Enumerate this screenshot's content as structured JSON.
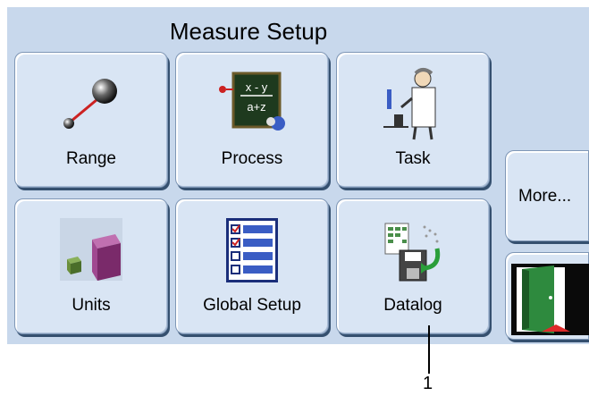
{
  "header": {
    "title": "Measure Setup"
  },
  "tiles": [
    {
      "label": "Range",
      "icon": "range-icon"
    },
    {
      "label": "Process",
      "icon": "process-icon"
    },
    {
      "label": "Task",
      "icon": "task-icon"
    },
    {
      "label": "Units",
      "icon": "units-icon"
    },
    {
      "label": "Global Setup",
      "icon": "global-setup-icon"
    },
    {
      "label": "Datalog",
      "icon": "datalog-icon"
    }
  ],
  "side": {
    "more_label": "More...",
    "exit_icon": "exit-door-icon"
  },
  "callout": {
    "number": "1"
  }
}
